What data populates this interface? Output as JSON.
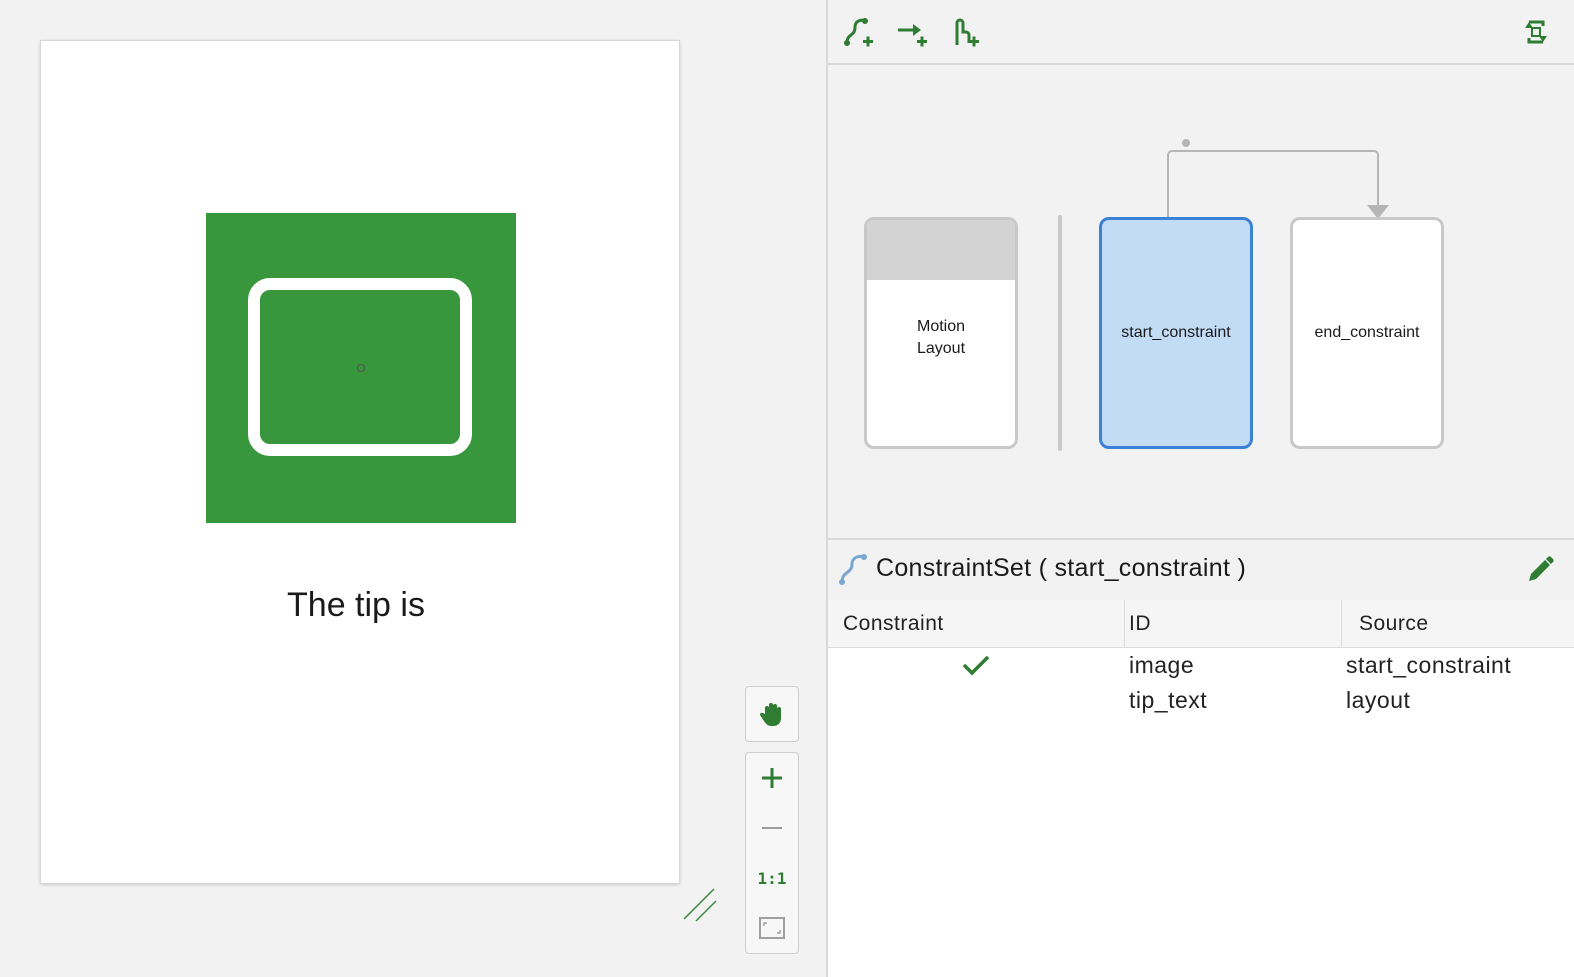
{
  "preview": {
    "tip_text": "The tip is",
    "zoom_controls": {
      "pan_icon": "hand-icon",
      "zoom_in_icon": "plus-icon",
      "zoom_out_icon": "minus-icon",
      "one_to_one_label": "1:1",
      "fit_icon": "fit-screen-icon"
    }
  },
  "toolbar": {
    "buttons": [
      "create-constraintset-icon",
      "create-transition-icon",
      "create-click-handler-icon",
      "cycle-layout-icon"
    ]
  },
  "overview": {
    "cards": {
      "motion_layout": "Motion Layout",
      "start": "start_constraint",
      "end": "end_constraint"
    },
    "selected": "start_constraint"
  },
  "constraint_set": {
    "title": "ConstraintSet ( start_constraint )",
    "columns": {
      "constraint": "Constraint",
      "id": "ID",
      "source": "Source"
    },
    "rows": [
      {
        "checked": true,
        "id": "image",
        "source": "start_constraint"
      },
      {
        "checked": false,
        "id": "tip_text",
        "source": "layout"
      }
    ]
  },
  "colors": {
    "accent_green": "#38963d",
    "icon_green": "#2e7d32",
    "selection_fill": "#c2dcf6",
    "selection_border": "#3b82d6"
  }
}
